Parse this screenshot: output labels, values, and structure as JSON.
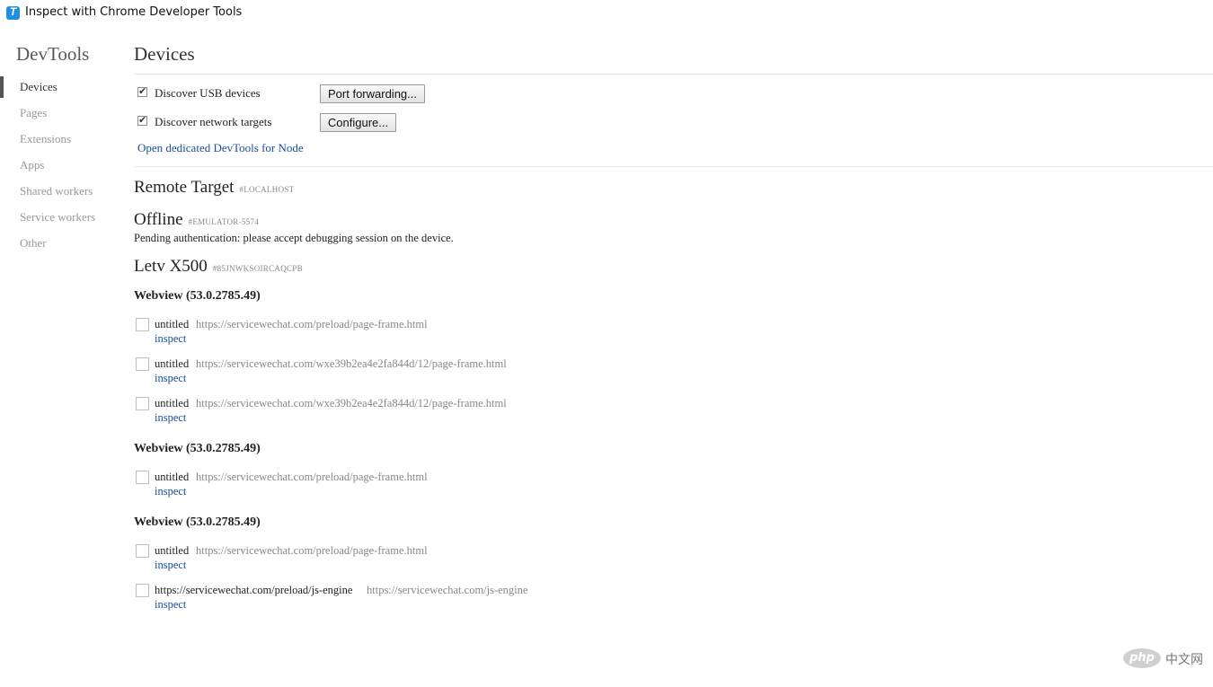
{
  "window": {
    "title": "Inspect with Chrome Developer Tools"
  },
  "sidebar": {
    "title": "DevTools",
    "items": [
      {
        "label": "Devices",
        "selected": true
      },
      {
        "label": "Pages"
      },
      {
        "label": "Extensions"
      },
      {
        "label": "Apps"
      },
      {
        "label": "Shared workers"
      },
      {
        "label": "Service workers"
      },
      {
        "label": "Other"
      }
    ]
  },
  "main": {
    "title": "Devices",
    "usb": {
      "label": "Discover USB devices",
      "checked": true,
      "button": "Port forwarding..."
    },
    "network": {
      "label": "Discover network targets",
      "checked": true,
      "button": "Configure..."
    },
    "node_link": "Open dedicated DevTools for Node",
    "devices": [
      {
        "name": "Remote Target",
        "serial": "#LOCALHOST"
      },
      {
        "name": "Offline",
        "serial": "#EMULATOR-5574",
        "status": "Pending authentication: please accept debugging session on the device."
      },
      {
        "name": "Letv X500",
        "serial": "#85JNWKSOIRCAQCPB",
        "browsers": [
          {
            "title": "Webview (53.0.2785.49)",
            "targets": [
              {
                "name": "untitled",
                "url": "https://servicewechat.com/preload/page-frame.html",
                "action": "inspect"
              },
              {
                "name": "untitled",
                "url": "https://servicewechat.com/wxe39b2ea4e2fa844d/12/page-frame.html",
                "action": "inspect"
              },
              {
                "name": "untitled",
                "url": "https://servicewechat.com/wxe39b2ea4e2fa844d/12/page-frame.html",
                "action": "inspect"
              }
            ]
          },
          {
            "title": "Webview (53.0.2785.49)",
            "targets": [
              {
                "name": "untitled",
                "url": "https://servicewechat.com/preload/page-frame.html",
                "action": "inspect"
              }
            ]
          },
          {
            "title": "Webview (53.0.2785.49)",
            "targets": [
              {
                "name": "untitled",
                "url": "https://servicewechat.com/preload/page-frame.html",
                "action": "inspect"
              },
              {
                "name": "https://servicewechat.com/preload/js-engine",
                "url": "https://servicewechat.com/js-engine",
                "action": "inspect"
              }
            ]
          }
        ]
      }
    ]
  },
  "watermark": {
    "logo": "php",
    "text": "中文网"
  }
}
